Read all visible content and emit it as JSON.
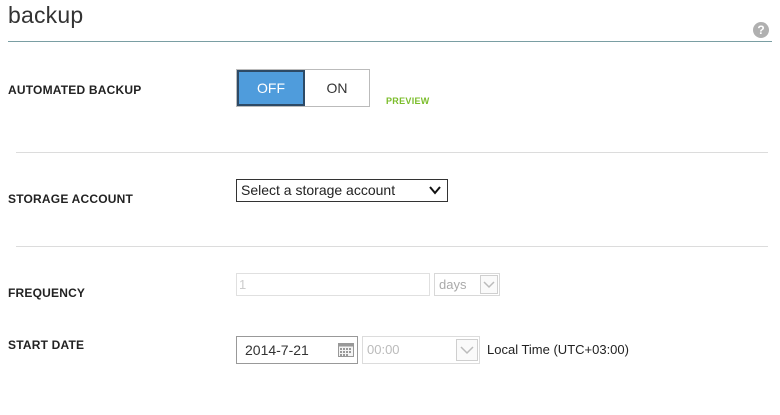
{
  "header": {
    "title": "backup",
    "help_glyph": "?"
  },
  "automated_backup": {
    "label": "AUTOMATED BACKUP",
    "off_label": "OFF",
    "on_label": "ON",
    "selected": "OFF",
    "preview_badge": "PREVIEW"
  },
  "storage_account": {
    "label": "STORAGE ACCOUNT",
    "selected": "Select a storage account"
  },
  "frequency": {
    "label": "FREQUENCY",
    "value": "1",
    "unit": "days"
  },
  "start_date": {
    "label": "START DATE",
    "date": "2014-7-21",
    "time": "00:00",
    "timezone": "Local Time (UTC+03:00)"
  },
  "colors": {
    "accent": "#4f9cdc",
    "preview_green": "#7bbd2b",
    "title_rule": "#7a9ea3"
  },
  "icons": [
    "help-icon",
    "chevron-down-icon",
    "calendar-icon"
  ]
}
